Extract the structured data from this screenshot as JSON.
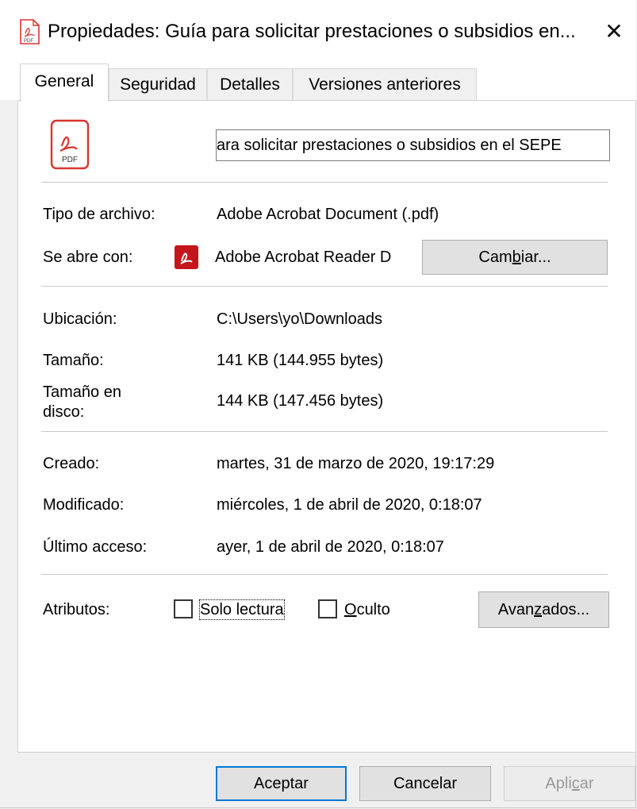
{
  "window": {
    "title": "Propiedades: Guía para solicitar prestaciones o subsidios en...",
    "close_glyph": "✕"
  },
  "tabs": [
    {
      "label": "General",
      "active": true
    },
    {
      "label": "Seguridad",
      "active": false
    },
    {
      "label": "Detalles",
      "active": false
    },
    {
      "label": "Versiones anteriores",
      "active": false
    }
  ],
  "file": {
    "icon": "pdf-file-icon",
    "icon_text": "PDF",
    "name_visible": "ara solicitar prestaciones o subsidios en el SEPE"
  },
  "type_section": {
    "type_label": "Tipo de archivo:",
    "type_value": "Adobe Acrobat Document (.pdf)",
    "opens_label": "Se abre con:",
    "opens_value": "Adobe Acrobat Reader D",
    "change_button": {
      "pre": "Cam",
      "accel": "b",
      "post": "iar..."
    }
  },
  "location_section": {
    "location_label": "Ubicación:",
    "location_value": "C:\\Users\\yo\\Downloads",
    "size_label": "Tamaño:",
    "size_value": "141 KB (144.955 bytes)",
    "disk_size_label_line1": "Tamaño en",
    "disk_size_label_line2": "disco:",
    "disk_size_value": "144 KB (147.456 bytes)"
  },
  "dates_section": {
    "created_label": "Creado:",
    "created_value": "martes, 31 de marzo de 2020, 19:17:29",
    "modified_label": "Modificado:",
    "modified_value": "miércoles, 1 de abril de 2020, 0:18:07",
    "accessed_label": "Último acceso:",
    "accessed_value": "ayer, 1 de abril de 2020, 0:18:07"
  },
  "attributes": {
    "label": "Atributos:",
    "readonly": {
      "label": "Solo lectura",
      "checked": false
    },
    "hidden": {
      "pre": "",
      "accel": "O",
      "post": "culto",
      "checked": false
    },
    "advanced_button": {
      "pre": "Avan",
      "accel": "z",
      "post": "ados..."
    }
  },
  "footer": {
    "ok_label": "Aceptar",
    "cancel_label": "Cancelar",
    "apply": {
      "pre": "Apli",
      "accel": "c",
      "post": "ar"
    }
  },
  "colors": {
    "accent": "#0078d7",
    "pdf_red": "#c4141c",
    "panel_bg": "#ffffff",
    "window_bg": "#f0f0f0"
  }
}
